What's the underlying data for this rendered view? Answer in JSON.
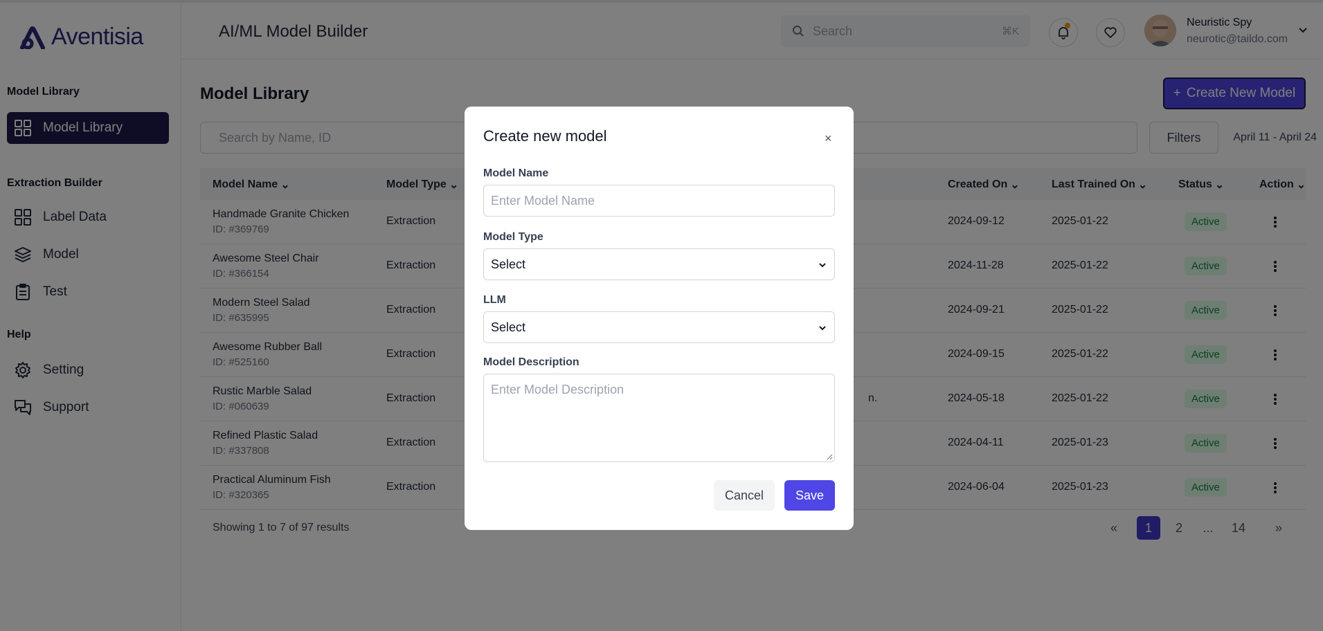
{
  "brand": {
    "name": "Aventisia"
  },
  "header": {
    "title": "AI/ML Model Builder",
    "search_placeholder": "Search",
    "search_shortcut": "⌘K",
    "user_name": "Neuristic Spy",
    "user_email": "neurotic@taildo.com"
  },
  "sidebar": {
    "sections": [
      {
        "title": "Model Library",
        "items": [
          {
            "label": "Model Library",
            "icon": "grid-icon",
            "active": true
          }
        ]
      },
      {
        "title": "Extraction Builder",
        "items": [
          {
            "label": "Label Data",
            "icon": "grid-icon"
          },
          {
            "label": "Model",
            "icon": "layers-icon"
          },
          {
            "label": "Test",
            "icon": "clipboard-icon"
          }
        ]
      },
      {
        "title": "Help",
        "items": [
          {
            "label": "Setting",
            "icon": "gear-icon"
          },
          {
            "label": "Support",
            "icon": "chat-icon"
          }
        ]
      }
    ]
  },
  "main": {
    "title": "Model Library",
    "create_button": "Create New Model",
    "search_placeholder": "Search by Name, ID",
    "filters_label": "Filters",
    "date_range": "April 11 - April 24",
    "columns": [
      "Model Name",
      "Model Type",
      "Created On",
      "Last Trained On",
      "Status",
      "Action"
    ],
    "rows": [
      {
        "name": "Handmade Granite Chicken",
        "id": "ID: #369769",
        "type": "Extraction",
        "desc_tail": "",
        "created": "2024-09-12",
        "trained": "2025-01-22",
        "status": "Active"
      },
      {
        "name": "Awesome Steel Chair",
        "id": "ID: #366154",
        "type": "Extraction",
        "desc_tail": "",
        "created": "2024-11-28",
        "trained": "2025-01-22",
        "status": "Active"
      },
      {
        "name": "Modern Steel Salad",
        "id": "ID: #635995",
        "type": "Extraction",
        "desc_tail": "",
        "created": "2024-09-21",
        "trained": "2025-01-22",
        "status": "Active"
      },
      {
        "name": "Awesome Rubber Ball",
        "id": "ID: #525160",
        "type": "Extraction",
        "desc_tail": "",
        "created": "2024-09-15",
        "trained": "2025-01-22",
        "status": "Active"
      },
      {
        "name": "Rustic Marble Salad",
        "id": "ID: #060639",
        "type": "Extraction",
        "desc_tail": "n.",
        "created": "2024-05-18",
        "trained": "2025-01-22",
        "status": "Active"
      },
      {
        "name": "Refined Plastic Salad",
        "id": "ID: #337808",
        "type": "Extraction",
        "desc_tail": "",
        "created": "2024-04-11",
        "trained": "2025-01-23",
        "status": "Active"
      },
      {
        "name": "Practical Aluminum Fish",
        "id": "ID: #320365",
        "type": "Extraction",
        "desc_tail": "",
        "created": "2024-06-04",
        "trained": "2025-01-23",
        "status": "Active"
      }
    ],
    "pagination": {
      "info": "Showing 1 to 7 of 97 results",
      "pages": [
        "1",
        "2",
        "...",
        "14"
      ],
      "current": "1"
    }
  },
  "modal": {
    "title": "Create new model",
    "close": "×",
    "fields": {
      "name_label": "Model Name",
      "name_placeholder": "Enter Model Name",
      "type_label": "Model Type",
      "type_value": "Select",
      "llm_label": "LLM",
      "llm_value": "Select",
      "desc_label": "Model Description",
      "desc_placeholder": "Enter Model Description"
    },
    "cancel": "Cancel",
    "save": "Save"
  },
  "colors": {
    "accent": "#4f46e5",
    "sidebar_active": "#1e1b4b",
    "status_bg": "#dcfce7",
    "status_text": "#15803d"
  }
}
